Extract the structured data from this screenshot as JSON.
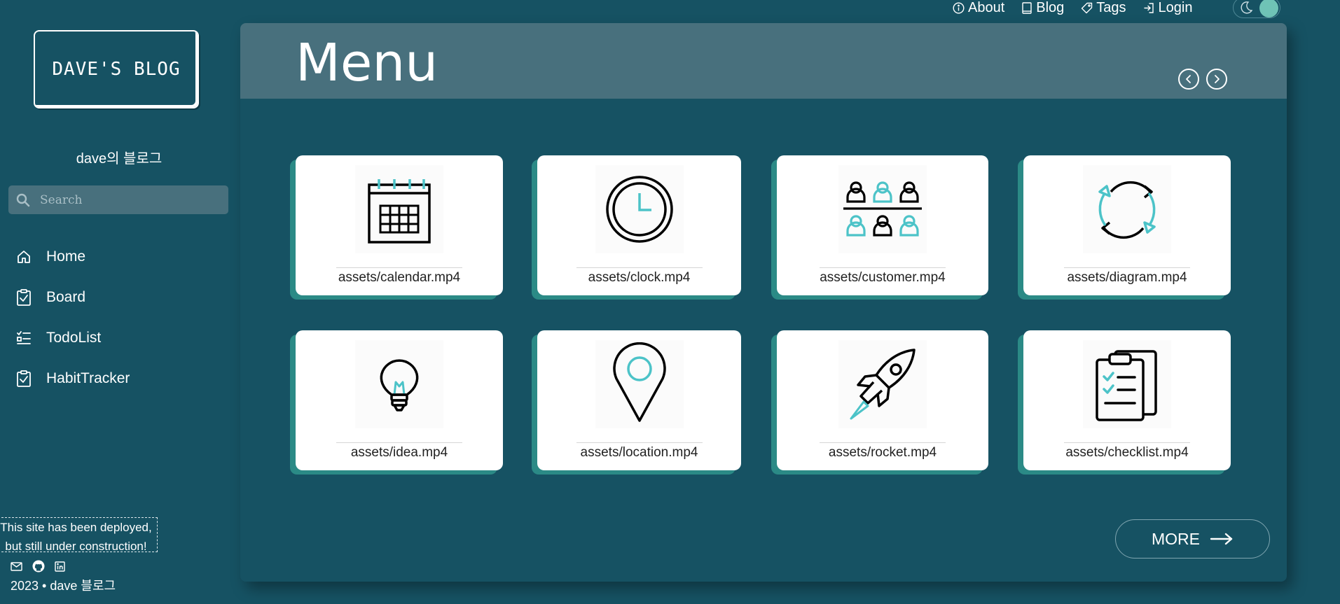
{
  "sidebar": {
    "logo_text": "DAVE'S BLOG",
    "subtitle": "dave의 블로그",
    "search_placeholder": "Search",
    "nav": [
      {
        "label": "Home",
        "icon": "home-icon"
      },
      {
        "label": "Board",
        "icon": "clipboard-check-icon"
      },
      {
        "label": "TodoList",
        "icon": "list-check-icon"
      },
      {
        "label": "HabitTracker",
        "icon": "clipboard-check-icon"
      }
    ],
    "notice_line1": "This site has been deployed,",
    "notice_line2": "but still under construction!",
    "socials": [
      "mail-icon",
      "github-icon",
      "linkedin-icon"
    ],
    "copyright": "2023 • dave 블로그"
  },
  "topnav": {
    "items": [
      {
        "label": "About",
        "icon": "info-icon"
      },
      {
        "label": "Blog",
        "icon": "book-icon"
      },
      {
        "label": "Tags",
        "icon": "tag-icon"
      },
      {
        "label": "Login",
        "icon": "login-icon"
      }
    ],
    "theme_toggle": "moon-icon"
  },
  "main": {
    "title": "Menu",
    "more_label": "MORE",
    "cards": [
      {
        "caption": "assets/calendar.mp4",
        "icon": "calendar-icon"
      },
      {
        "caption": "assets/clock.mp4",
        "icon": "clock-icon"
      },
      {
        "caption": "assets/customer.mp4",
        "icon": "customer-icon"
      },
      {
        "caption": "assets/diagram.mp4",
        "icon": "cycle-diagram-icon"
      },
      {
        "caption": "assets/idea.mp4",
        "icon": "lightbulb-icon"
      },
      {
        "caption": "assets/location.mp4",
        "icon": "location-pin-icon"
      },
      {
        "caption": "assets/rocket.mp4",
        "icon": "rocket-icon"
      },
      {
        "caption": "assets/checklist.mp4",
        "icon": "checklist-icon"
      }
    ]
  },
  "colors": {
    "background": "#165263",
    "header_bar": "#48707d",
    "accent_teal": "#4cc3c8",
    "card_shadow": "#2b8a86"
  }
}
